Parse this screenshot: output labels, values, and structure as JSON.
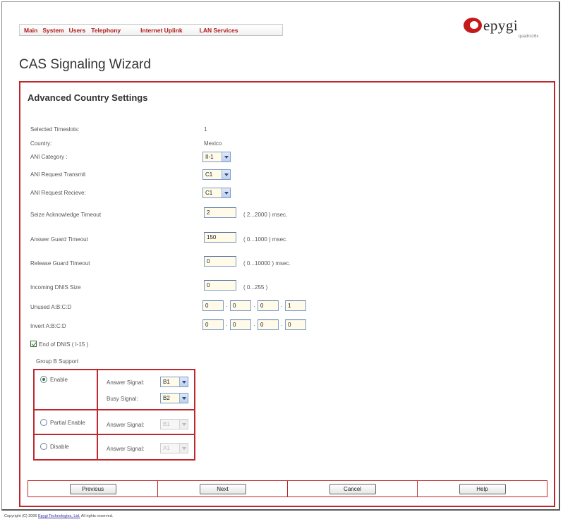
{
  "menu": {
    "items": [
      "Main",
      "System",
      "Users",
      "Telephony",
      "Internet Uplink",
      "LAN Services"
    ]
  },
  "logo": {
    "brand": "epygi",
    "model": "quadro16x"
  },
  "page": {
    "title": "CAS Signaling Wizard"
  },
  "panel": {
    "title": "Advanced Country Settings",
    "selected_timeslots": {
      "label": "Selected Timeslots:",
      "value": "1"
    },
    "country": {
      "label": "Country:",
      "value": "Mexico"
    },
    "ani_category": {
      "label": "ANI Category :",
      "value": "II-1"
    },
    "ani_request_transmit": {
      "label": "ANI Request Transmit",
      "value": "C1"
    },
    "ani_request_recieve": {
      "label": "ANI Request Recieve:",
      "value": "C1"
    },
    "seize_ack_timeout": {
      "label": "Seize Acknowledge Timeout",
      "value": "2",
      "range": "( 2...2000 ) msec."
    },
    "answer_guard_timeout": {
      "label": "Answer Guard Timeout",
      "value": "150",
      "range": "( 0...1000 ) msec."
    },
    "release_guard_timeout": {
      "label": "Release Guard Timeout",
      "value": "0",
      "range": "( 0...10000 ) msec."
    },
    "incoming_dnis_size": {
      "label": "Incoming DNIS Size",
      "value": "0",
      "range": "( 0...255 )"
    },
    "unused_abcd": {
      "label": "Unused A:B:C:D",
      "values": [
        "0",
        "0",
        "0",
        "1"
      ]
    },
    "invert_abcd": {
      "label": "Invert A:B:C:D",
      "values": [
        "0",
        "0",
        "0",
        "0"
      ]
    },
    "end_of_dnis": {
      "label": "End of DNIS ( I-15 )",
      "checked": true
    },
    "group_b": {
      "label": "Group B Support",
      "enable": {
        "label": "Enable",
        "selected": true,
        "answer_signal_label": "Answer Signal:",
        "answer_signal": "B1",
        "busy_signal_label": "Busy Signal:",
        "busy_signal": "B2"
      },
      "partial_enable": {
        "label": "Partial Enable",
        "selected": false,
        "answer_signal_label": "Answer Signal:",
        "answer_signal": "B1"
      },
      "disable": {
        "label": "Disable",
        "selected": false,
        "answer_signal_label": "Answer Signal:",
        "answer_signal": "A1"
      }
    }
  },
  "buttons": {
    "previous": "Previous",
    "next": "Next",
    "cancel": "Cancel",
    "help": "Help"
  },
  "footer": {
    "prefix": "Copyright (C) 2006 ",
    "link": "Epygi Technologies, Ltd.",
    "suffix": " All rights reserved."
  },
  "colors": {
    "accent_red": "#c0272d",
    "menu_red": "#b01818",
    "input_bg": "#fffbe8"
  }
}
